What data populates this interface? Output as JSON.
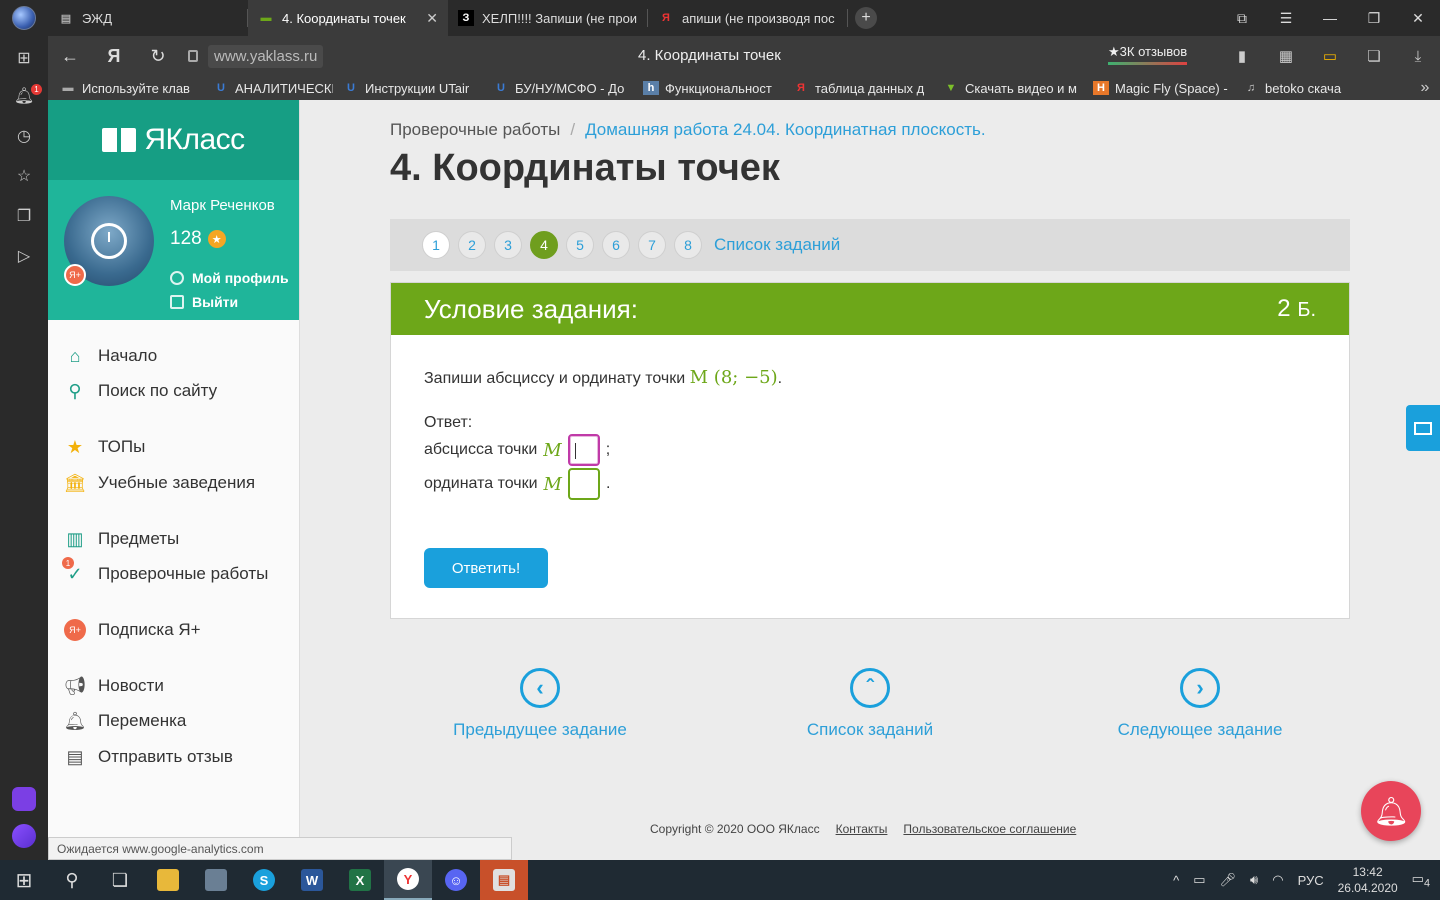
{
  "browser": {
    "tabs": [
      {
        "title": "ЭЖД",
        "active": false
      },
      {
        "title": "4. Координаты точек",
        "active": true
      },
      {
        "title": "ХЕЛП!!!! Запиши (не прои",
        "active": false
      },
      {
        "title": "апиши (не производя пос",
        "active": false
      }
    ],
    "url": "www.yaklass.ru",
    "page_title": "4. Координаты точек",
    "reviews": "★3К отзывов",
    "bookmarks": [
      "Используйте клав",
      "АНАЛИТИЧЕСКИЕ",
      "Инструкции UTair",
      "БУ/НУ/МСФО - До",
      "Функциональност",
      "таблица данных д",
      "Скачать видео и м",
      "Magic Fly (Space) -",
      "betoko скача"
    ],
    "notification_badge": "1",
    "status": "Ожидается www.google-analytics.com"
  },
  "site": {
    "logo": "ЯКласс",
    "user": {
      "name": "Марк Реченков",
      "score": "128",
      "profile": "Мой профиль",
      "logout": "Выйти",
      "plus_badge": "Я+"
    },
    "menu": [
      {
        "label": "Начало"
      },
      {
        "label": "Поиск по сайту"
      },
      {
        "label": "ТОПы"
      },
      {
        "label": "Учебные заведения"
      },
      {
        "label": "Предметы"
      },
      {
        "label": "Проверочные работы",
        "badge": "1"
      },
      {
        "label": "Подписка Я+"
      },
      {
        "label": "Новости"
      },
      {
        "label": "Переменка"
      },
      {
        "label": "Отправить отзыв"
      }
    ]
  },
  "main": {
    "breadcrumb": {
      "root": "Проверочные работы",
      "separator": "/",
      "current": "Домашняя работа 24.04. Координатная плоскость."
    },
    "title": "4. Координаты точек",
    "task_numbers": [
      "1",
      "2",
      "3",
      "4",
      "5",
      "6",
      "7",
      "8"
    ],
    "current_task": "4",
    "task_list_link": "Список заданий",
    "card": {
      "header": "Условие задания:",
      "points": "2",
      "points_unit": "Б.",
      "question": "Запиши абсциссу и ординату точки",
      "point_math": "M (8; −5)",
      "answer_label": "Ответ:",
      "abscissa_label": "абсцисса точки",
      "ordinate_label": "ордината точки",
      "point_letter": "M",
      "abscissa_value": "",
      "ordinate_value": "",
      "submit": "Ответить!"
    },
    "bottom_nav": {
      "prev": "Предыдущее задание",
      "list": "Список заданий",
      "next": "Следующее задание"
    },
    "footer": {
      "copyright": "Copyright © 2020 ООО ЯКласс",
      "contacts": "Контакты",
      "agreement": "Пользовательское соглашение"
    }
  },
  "taskbar": {
    "language": "РУС",
    "time": "13:42",
    "date": "26.04.2020",
    "notifications": "4"
  },
  "colors": {
    "accent_green": "#6da719",
    "teal": "#1fb59a",
    "link_blue": "#2d9fd8",
    "button_blue": "#1aa0dc"
  }
}
